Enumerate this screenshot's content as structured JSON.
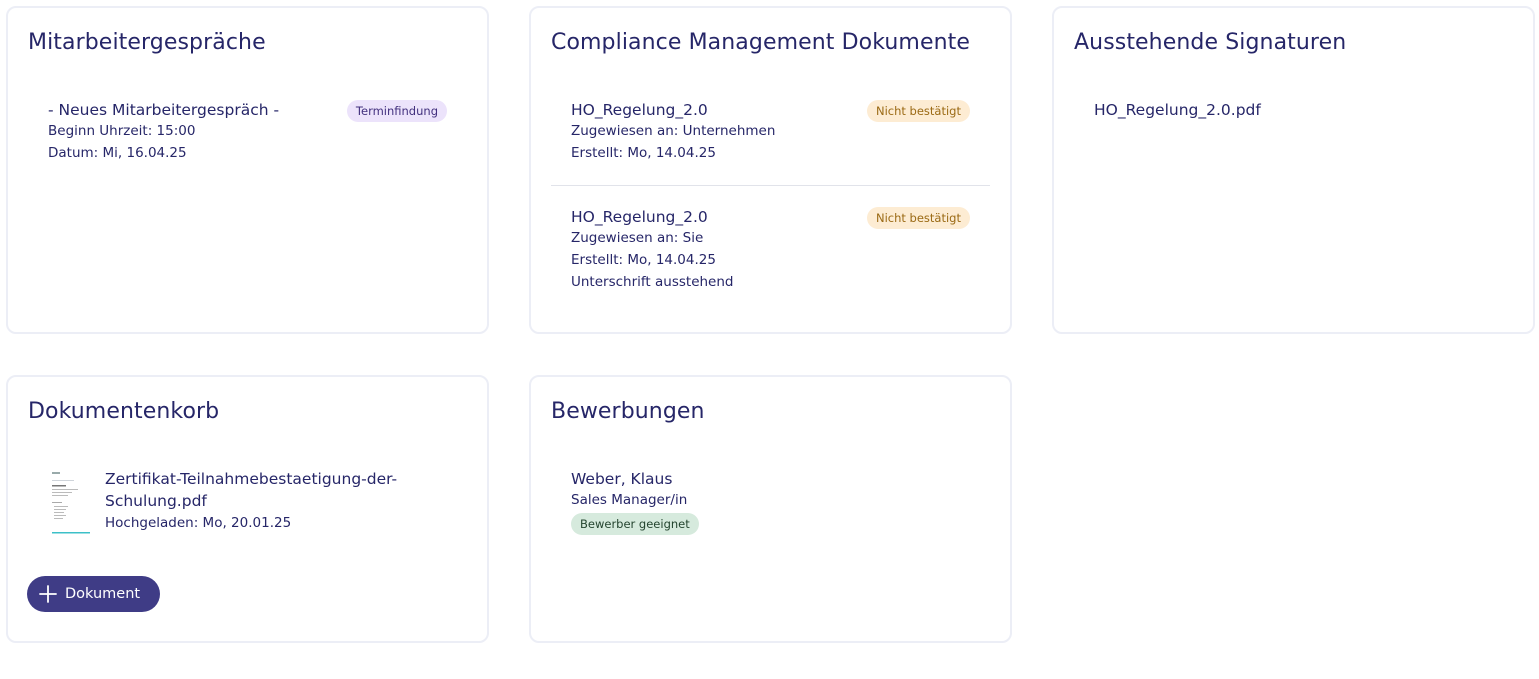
{
  "mitarbeitergespraeche": {
    "title": "Mitarbeitergespräche",
    "entry": {
      "title": "- Neues Mitarbeitergespräch -",
      "badge": "Terminfindung",
      "line1": "Beginn Uhrzeit: 15:00",
      "line2": "Datum: Mi, 16.04.25"
    }
  },
  "compliance": {
    "title": "Compliance Management Dokumente",
    "items": [
      {
        "title": "HO_Regelung_2.0",
        "badge": "Nicht bestätigt",
        "line1": "Zugewiesen an: Unternehmen",
        "line2": "Erstellt: Mo, 14.04.25"
      },
      {
        "title": "HO_Regelung_2.0",
        "badge": "Nicht bestätigt",
        "line1": "Zugewiesen an: Sie",
        "line2": "Erstellt: Mo, 14.04.25",
        "line3": "Unterschrift ausstehend"
      }
    ]
  },
  "signaturen": {
    "title": "Ausstehende Signaturen",
    "items": [
      {
        "name": "HO_Regelung_2.0.pdf"
      }
    ]
  },
  "dokumentenkorb": {
    "title": "Dokumentenkorb",
    "file": {
      "name_line1": "Zertifikat-Teilnahmebestaetigung-der-",
      "name_line2": "Schulung.pdf",
      "uploaded": "Hochgeladen: Mo, 20.01.25",
      "thumbnail_icon": "pdf-thumbnail-icon"
    },
    "add_label": "Dokument",
    "add_icon": "plus-icon"
  },
  "bewerbungen": {
    "title": "Bewerbungen",
    "applicant": {
      "name": "Weber, Klaus",
      "position": "Sales Manager/in",
      "badge": "Bewerber geeignet"
    }
  },
  "colors": {
    "title_text": "#262668",
    "button": "#3f3c86",
    "badge_purple": "#ece3fb",
    "badge_orange": "#fdecd3",
    "badge_green": "#d6eadd",
    "card_border": "#eceef6"
  }
}
